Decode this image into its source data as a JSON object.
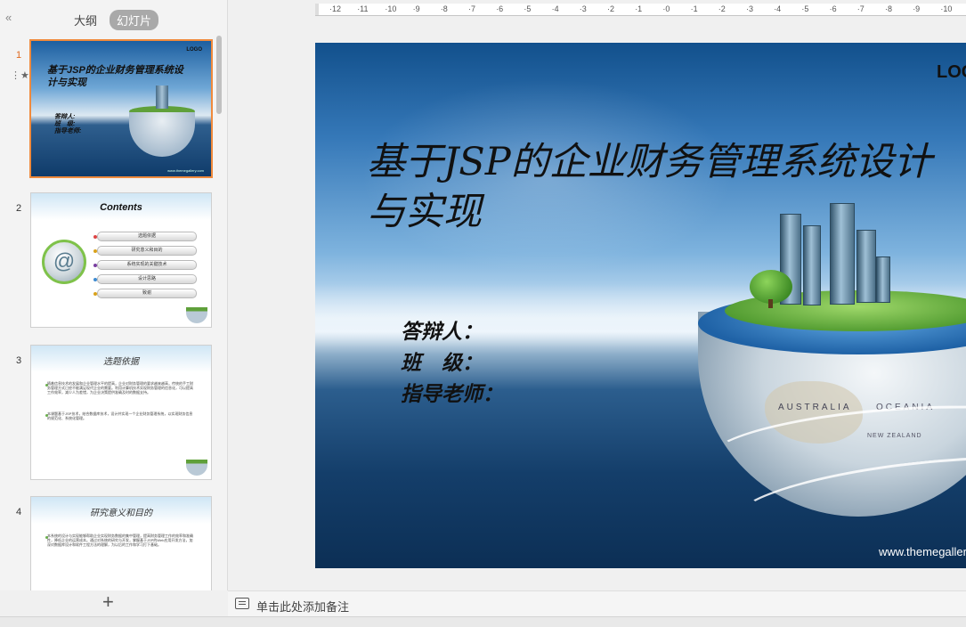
{
  "left_panel": {
    "tabs": [
      {
        "label": "大纲"
      },
      {
        "label": "幻灯片",
        "active": true
      }
    ],
    "slides": [
      {
        "number": "1",
        "thumb": {
          "logo": "LOGO",
          "title": "基于JSP的企业财务管理系统设计与实现",
          "lines": [
            "答辩人:",
            "班　级:",
            "指导老师:"
          ],
          "url": "www.themegallery.com"
        }
      },
      {
        "number": "2",
        "thumb": {
          "title": "Contents",
          "items": [
            "选题依据",
            "研究意义和目的",
            "系统实现的关键技术",
            "设计思路",
            "致谢"
          ]
        }
      },
      {
        "number": "3",
        "thumb": {
          "title": "选题依据",
          "paragraphs": [
            "随着信息技术的发展和企业管理水平的提高，企业对财务管理的要求越来越高，传统的手工财务管理方式已经不能满足现代企业的需要。利用计算机技术实现财务管理的信息化，可以提高工作效率，减少人为差错，为企业决策提供准确及时的数据支持。",
            "本课题基于JSP技术，结合数据库技术，设计并实现一个企业财务管理系统，以实现财务信息的规范化、系统化管理。"
          ]
        }
      },
      {
        "number": "4",
        "thumb": {
          "title": "研究意义和目的",
          "paragraphs": [
            "本系统的设计与实现能够帮助企业实现财务数据的集中管理，提高财务管理工作的效率和准确性，降低企业的运营成本。通过对系统的研究与开发，掌握基于JSP的Web应用开发方法，加深对数据库设计和软件工程方法的理解，为以后的工作和学习打下基础。"
          ]
        }
      }
    ],
    "add_slide_label": "+"
  },
  "ruler": {
    "labels": [
      "12",
      "11",
      "10",
      "9",
      "8",
      "7",
      "6",
      "5",
      "4",
      "3",
      "2",
      "1",
      "0",
      "1",
      "2",
      "3",
      "4",
      "5",
      "6",
      "7",
      "8",
      "9",
      "10"
    ]
  },
  "main_slide": {
    "logo": "LOGO",
    "title": "基于JSP的企业财务管理系统设计与实现",
    "fields": [
      "答辩人：",
      "班　级：",
      "指导老师："
    ],
    "map_labels": {
      "australia": "AUSTRALIA",
      "oceania": "OCEANIA",
      "new_zealand": "NEW ZEALAND"
    },
    "url": "www.themegallery.com"
  },
  "notes": {
    "placeholder": "单击此处添加备注"
  },
  "colors": {
    "accent_selected": "#f08a3c",
    "active_slide_number": "#e0691e"
  }
}
